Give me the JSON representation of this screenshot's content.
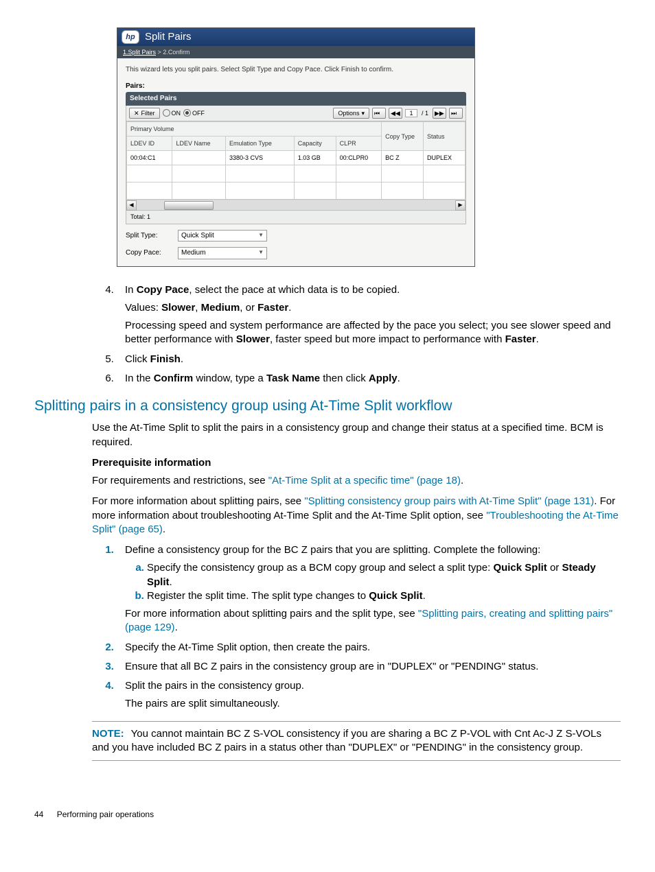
{
  "wizard": {
    "logo": "hp",
    "title": "Split Pairs",
    "breadcrumb": {
      "step1": "1.Split Pairs",
      "sep": ">",
      "step2": "2.Confirm"
    },
    "instruction": "This wizard lets you split pairs. Select Split Type and Copy Pace. Click Finish to confirm.",
    "pairs_label": "Pairs:",
    "selected_pairs_header": "Selected Pairs",
    "filter_btn": "Filter",
    "on_label": "ON",
    "off_label": "OFF",
    "options_btn": "Options",
    "page_cur": "1",
    "page_total": "/ 1",
    "group_header": "Primary Volume",
    "cols": {
      "ldev_id": "LDEV ID",
      "ldev_name": "LDEV Name",
      "emu_type": "Emulation Type",
      "capacity": "Capacity",
      "clpr": "CLPR",
      "copy_type": "Copy Type",
      "status": "Status"
    },
    "row": {
      "ldev_id": "00:04:C1",
      "ldev_name": "",
      "emu_type": "3380-3 CVS",
      "capacity": "1.03 GB",
      "clpr": "00:CLPR0",
      "copy_type": "BC Z",
      "status": "DUPLEX"
    },
    "total_label": "Total:  1",
    "split_type_label": "Split Type:",
    "split_type_value": "Quick Split",
    "copy_pace_label": "Copy Pace:",
    "copy_pace_value": "Medium"
  },
  "doc": {
    "step4": {
      "text1": "In ",
      "b1": "Copy Pace",
      "text2": ", select the pace at which data is to be copied.",
      "values_prefix": "Values: ",
      "v1": "Slower",
      "v2": "Medium",
      "v3": "Faster",
      "comma": ", ",
      "or": ", or ",
      "dot": ".",
      "para_a": "Processing speed and system performance are affected by the pace you select; you see slower speed and better performance with ",
      "para_b": "Slower",
      "para_c": ", faster speed but more impact to performance with ",
      "para_d": "Faster",
      "para_e": "."
    },
    "step5": {
      "a": "Click ",
      "b": "Finish",
      "c": "."
    },
    "step6": {
      "a": "In the ",
      "b": "Confirm",
      "c": " window, type a ",
      "d": "Task Name",
      "e": " then click ",
      "f": "Apply",
      "g": "."
    },
    "section_heading": "Splitting pairs in a consistency group using At-Time Split workflow",
    "intro": "Use the At-Time Split to split the pairs in a consistency group and change their status at a specified time. BCM is required.",
    "prereq_heading": "Prerequisite information",
    "prereq_line": {
      "a": "For requirements and restrictions, see ",
      "link": "\"At-Time Split at a specific time\" (page 18)",
      "b": "."
    },
    "more_info": {
      "a": "For more information about splitting pairs, see ",
      "link1": "\"Splitting consistency group pairs with At-Time Split\" (page 131)",
      "b": ". For more information about troubleshooting At-Time Split and the At-Time Split option, see ",
      "link2": "\"Troubleshooting the At-Time Split\" (page 65)",
      "c": "."
    },
    "s1": "Define a consistency group for the BC Z pairs that you are splitting. Complete the following:",
    "s1a": {
      "a": "Specify the consistency group as a BCM copy group and select a split type: ",
      "b": "Quick Split",
      "c": " or ",
      "d": "Steady Split",
      "e": "."
    },
    "s1b": {
      "a": "Register the split time. The split type changes to ",
      "b": "Quick Split",
      "c": "."
    },
    "s1_tail": {
      "a": "For more information about splitting pairs and the split type, see ",
      "link": "\"Splitting pairs, creating and splitting pairs\" (page 129)",
      "b": "."
    },
    "s2": "Specify the At-Time Split option, then create the pairs.",
    "s3": "Ensure that all BC Z pairs in the consistency group are in \"DUPLEX\" or \"PENDING\" status.",
    "s4": "Split the pairs in the consistency group.",
    "s4_tail": "The pairs are split simultaneously.",
    "note_label": "NOTE:",
    "note_text": "You cannot maintain BC Z S-VOL consistency if you are sharing a BC Z P-VOL with Cnt Ac-J Z S-VOLs and you have included BC Z pairs in a status other than \"DUPLEX\" or \"PENDING\" in the consistency group.",
    "footer_page": "44",
    "footer_title": "Performing pair operations"
  }
}
